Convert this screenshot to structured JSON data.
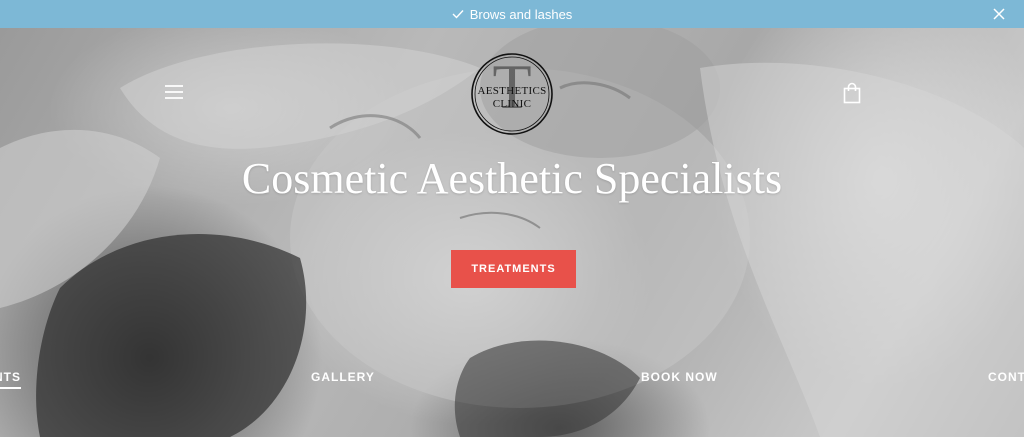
{
  "announcement": {
    "text": "Brows and lashes",
    "icon": "check-icon",
    "close_icon": "close-icon",
    "background": "#7db8d6"
  },
  "header": {
    "menu_icon": "hamburger-menu-icon",
    "cart_icon": "shopping-bag-icon",
    "logo": {
      "monogram": "T",
      "line1": "AESTHETICS",
      "line2": "CLINIC"
    }
  },
  "hero": {
    "headline": "Cosmetic Aesthetic Specialists",
    "cta_label": "TREATMENTS",
    "cta_color": "#e8514a"
  },
  "bottom_nav": {
    "items": [
      {
        "label": "MENTS",
        "active": true
      },
      {
        "label": "GALLERY",
        "active": false
      },
      {
        "label": "BOOK NOW",
        "active": false
      },
      {
        "label": "CONTA",
        "active": false
      }
    ]
  }
}
